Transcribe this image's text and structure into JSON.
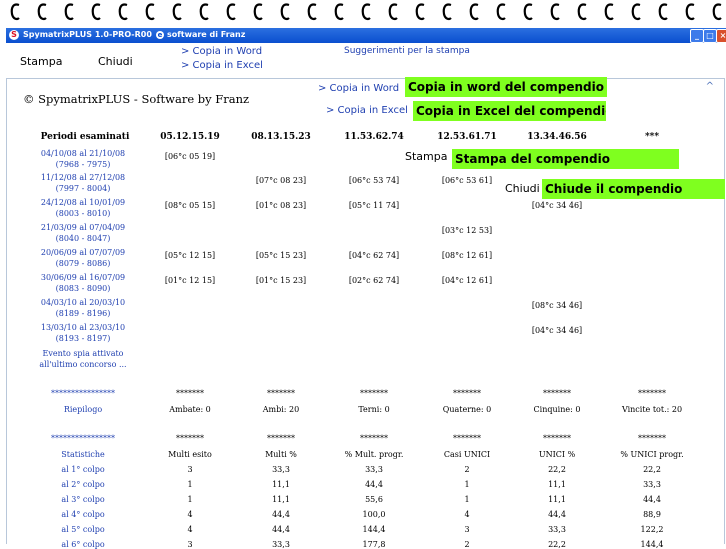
{
  "window": {
    "title": "SpymatrixPLUS 1.0-PRO-R00",
    "subtitle": "software di Franz",
    "app_icon": "S"
  },
  "menu": {
    "stampa": "Stampa",
    "chiudi": "Chiudi",
    "copia_word": "> Copia in Word",
    "copia_excel": "> Copia in Excel",
    "suggerimenti": "Suggerimenti per la stampa"
  },
  "content": {
    "brand": "© SpymatrixPLUS - Software by Franz",
    "actions": {
      "copia_word": "> Copia in Word",
      "copia_excel": "> Copia in Excel",
      "stampa": "Stampa",
      "chiudi": "Chiudi"
    },
    "notes": {
      "copia_word": "Copia in word del compendio",
      "copia_excel": "Copia in Excel del compendio",
      "stampa": "Stampa del compendio",
      "chiudi": "Chiude il compendio"
    },
    "headers": [
      "Periodi esaminati",
      "05.12.15.19",
      "08.13.15.23",
      "11.53.62.74",
      "12.53.61.71",
      "13.34.46.56",
      "***"
    ],
    "periods": [
      {
        "label": "04/10/08 al 21/10/08 (7968 - 7975)",
        "vals": [
          "[06°c 05 19]",
          "",
          "",
          "",
          ""
        ]
      },
      {
        "label": "11/12/08 al 27/12/08 (7997 - 8004)",
        "vals": [
          "",
          "[07°c 08 23]",
          "[06°c 53 74]",
          "[06°c 53 61]",
          ""
        ]
      },
      {
        "label": "24/12/08 al 10/01/09 (8003 - 8010)",
        "vals": [
          "[08°c 05 15]",
          "[01°c 08 23]",
          "[05°c 11 74]",
          "",
          "[04°c 34 46]"
        ]
      },
      {
        "label": "21/03/09 al 07/04/09 (8040 - 8047)",
        "vals": [
          "",
          "",
          "",
          "[03°c 12 53]",
          ""
        ]
      },
      {
        "label": "20/06/09 al 07/07/09 (8079 - 8086)",
        "vals": [
          "[05°c 12 15]",
          "[05°c 15 23]",
          "[04°c 62 74]",
          "[08°c 12 61]",
          ""
        ]
      },
      {
        "label": "30/06/09 al 16/07/09 (8083 - 8090)",
        "vals": [
          "[01°c 12 15]",
          "[01°c 15 23]",
          "[02°c 62 74]",
          "[04°c 12 61]",
          ""
        ]
      },
      {
        "label": "04/03/10 al 20/03/10 (8189 - 8196)",
        "vals": [
          "",
          "",
          "",
          "",
          "[08°c 34 46]"
        ]
      },
      {
        "label": "13/03/10 al 23/03/10 (8193 - 8197)",
        "vals": [
          "",
          "",
          "",
          "",
          "[04°c 34 46]"
        ]
      }
    ],
    "evento": "Evento spia attivato all'ultimo concorso ...",
    "separator_blue": "****************",
    "separator": "*******",
    "riepilogo": {
      "label": "Riepilogo",
      "vals": [
        "Ambate: 0",
        "Ambi: 20",
        "Terni: 0",
        "Quaterne: 0",
        "Cinquine: 0",
        "Vincite tot.: 20"
      ]
    },
    "statistiche": {
      "label": "Statistiche",
      "headers": [
        "Multi esito",
        "Multi %",
        "% Mult. progr.",
        "Casi UNICI",
        "UNICI %",
        "% UNICI progr."
      ],
      "rows": [
        {
          "label": "al 1° colpo",
          "vals": [
            "3",
            "33,3",
            "33,3",
            "2",
            "22,2",
            "22,2"
          ]
        },
        {
          "label": "al 2° colpo",
          "vals": [
            "1",
            "11,1",
            "44,4",
            "1",
            "11,1",
            "33,3"
          ]
        },
        {
          "label": "al 3° colpo",
          "vals": [
            "1",
            "11,1",
            "55,6",
            "1",
            "11,1",
            "44,4"
          ]
        },
        {
          "label": "al 4° colpo",
          "vals": [
            "4",
            "44,4",
            "100,0",
            "4",
            "44,4",
            "88,9"
          ]
        },
        {
          "label": "al 5° colpo",
          "vals": [
            "4",
            "44,4",
            "144,4",
            "3",
            "33,3",
            "122,2"
          ]
        },
        {
          "label": "al 6° colpo",
          "vals": [
            "3",
            "33,3",
            "177,8",
            "2",
            "22,2",
            "144,4"
          ]
        }
      ]
    }
  }
}
